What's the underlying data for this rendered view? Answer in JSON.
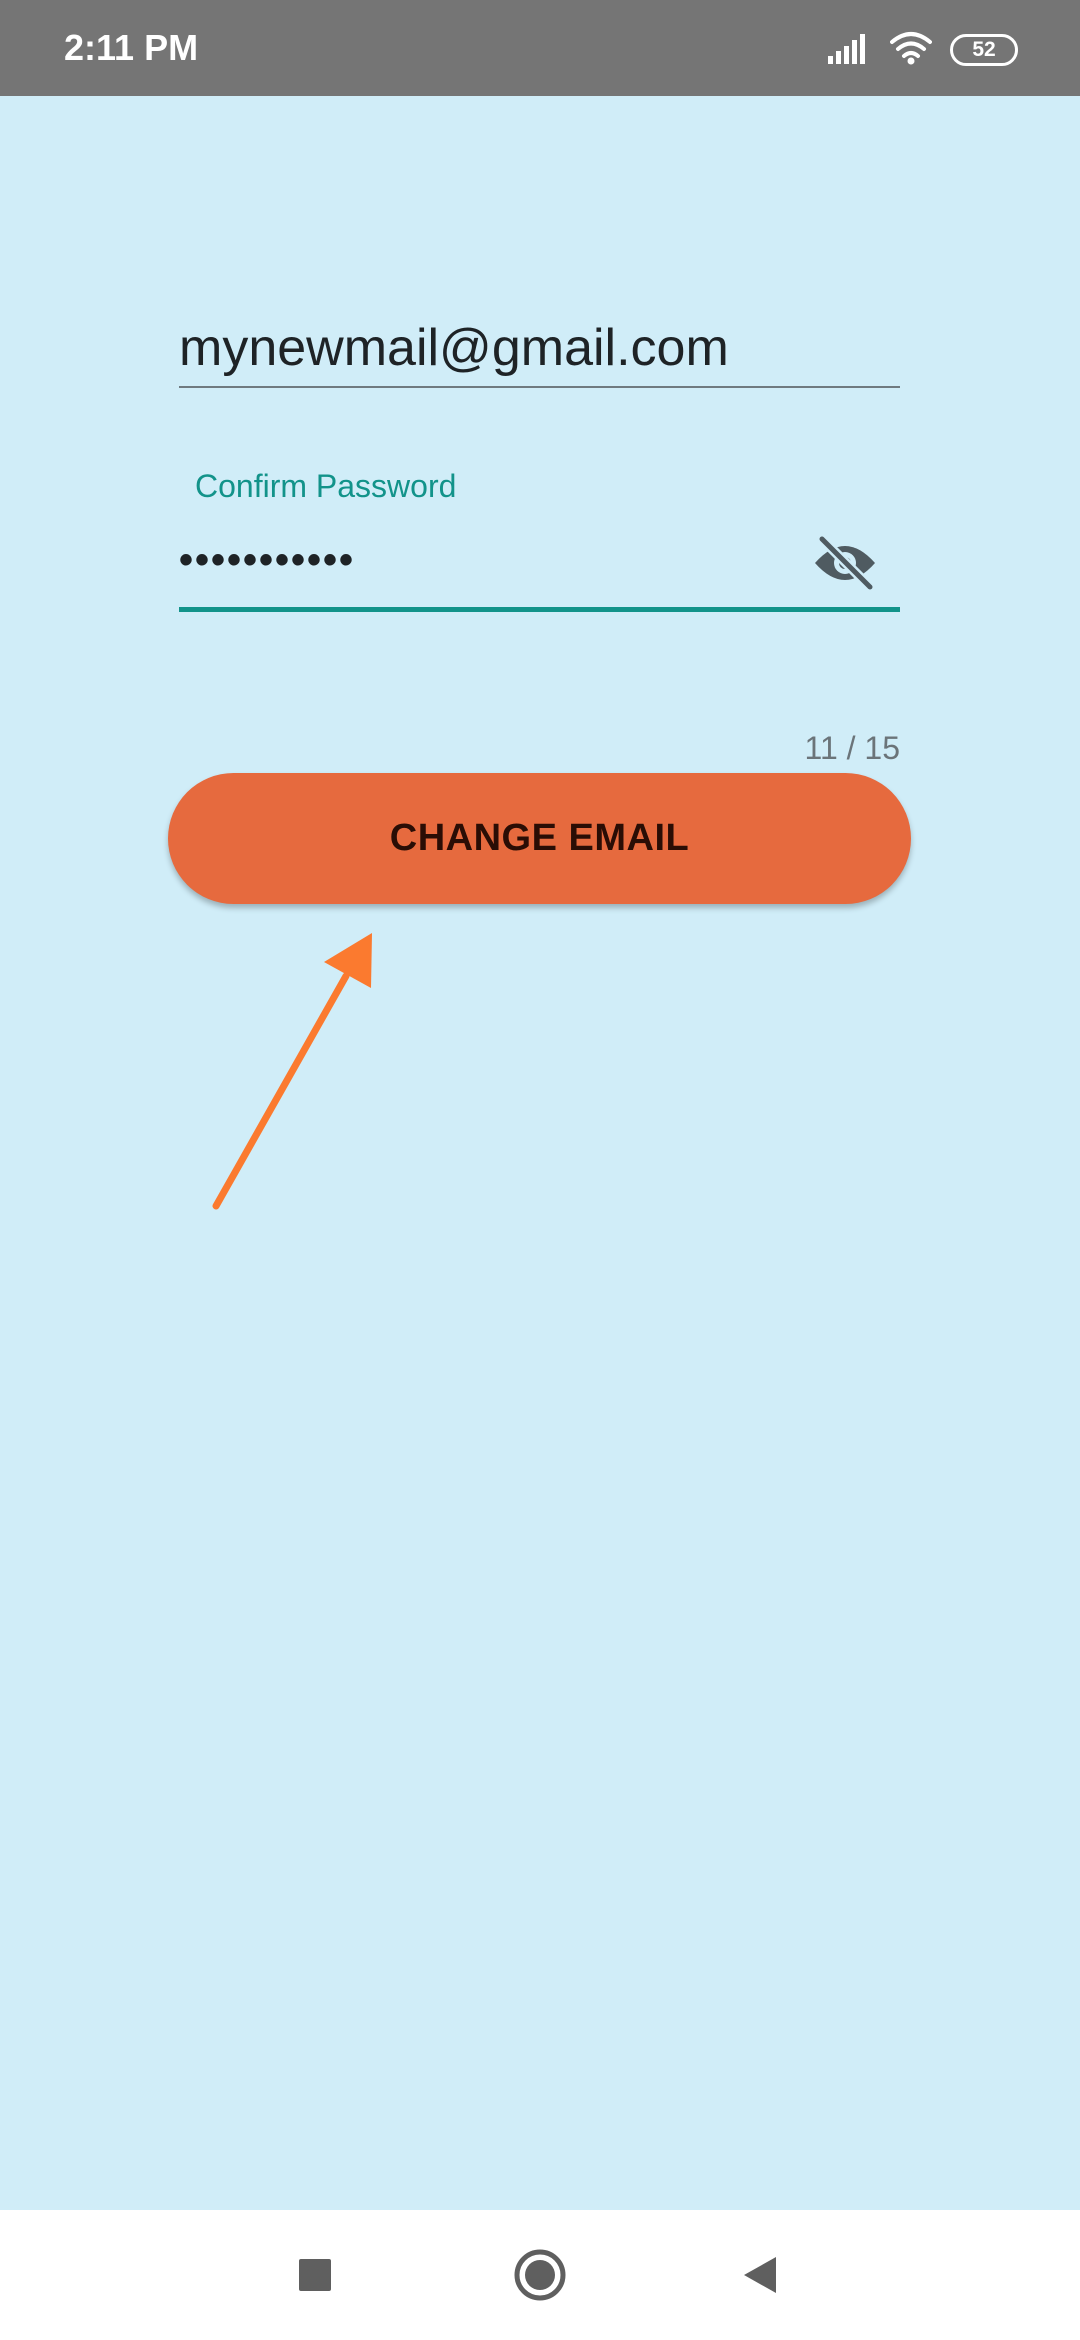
{
  "status_bar": {
    "time": "2:11 PM",
    "battery": "52",
    "icons": [
      "signal-icon",
      "wifi-icon",
      "battery-icon"
    ]
  },
  "form": {
    "email_value": "mynewmail@gmail.com",
    "password_label": "Confirm Password",
    "password_value": "•••••••••••",
    "password_visibility_icon": "eye-off-icon",
    "char_counter": "11 / 15"
  },
  "actions": {
    "change_email_label": "CHANGE EMAIL"
  },
  "annotation": {
    "arrow_icon": "arrow-icon",
    "arrow_color": "#fb7a2f"
  },
  "nav_bar": {
    "icons": [
      "recents-square-icon",
      "home-circle-icon",
      "back-triangle-icon"
    ]
  },
  "colors": {
    "background": "#d0edf8",
    "accent": "#12938a",
    "button": "#e66a3e",
    "status_bar": "#757575"
  }
}
